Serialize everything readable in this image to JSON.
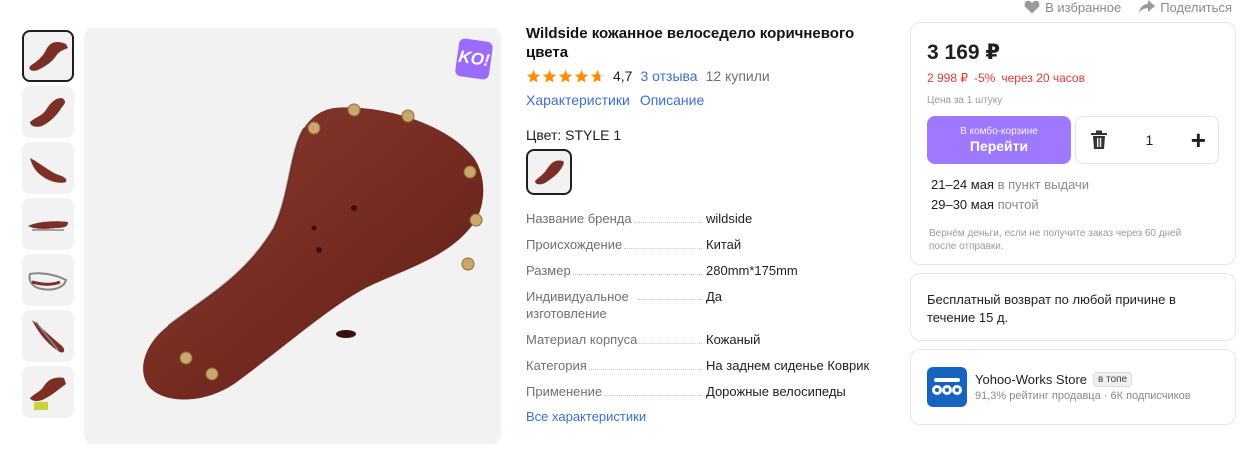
{
  "top_actions": {
    "favorite_label": "В избранное",
    "share_label": "Поделиться"
  },
  "gallery": {
    "thumbnails": [
      "thumb-1",
      "thumb-2",
      "thumb-3",
      "thumb-4",
      "thumb-5",
      "thumb-6",
      "thumb-7"
    ],
    "active_index": 0,
    "badge_text": "KO!"
  },
  "product": {
    "title": "Wildside кожанное велоседело коричневого цвета",
    "rating": "4,7",
    "rating_stars": 4.7,
    "reviews_link": "3 отзыва",
    "bought_text": "12 купили",
    "tab_characteristics": "Характеристики",
    "tab_description": "Описание",
    "color_label": "Цвет: STYLE 1",
    "specs": [
      {
        "key": "Название бренда",
        "value": "wildside"
      },
      {
        "key": "Происхождение",
        "value": "Китай"
      },
      {
        "key": "Размер",
        "value": "280mm*175mm"
      },
      {
        "key": "Индивидуальное изготовление",
        "value": "Да"
      },
      {
        "key": "Материал корпуса",
        "value": "Кожаный"
      },
      {
        "key": "Категория",
        "value": "На заднем сиденье Коврик"
      },
      {
        "key": "Применение",
        "value": "Дорожные велосипеды"
      }
    ],
    "all_specs_link": "Все характеристики"
  },
  "buy": {
    "price": "3 169 ₽",
    "discount_price": "2 998 ₽",
    "discount_percent": "-5%",
    "discount_time": "через 20 часов",
    "per_unit": "Цена за 1 штуку",
    "combo_small": "В комбо-корзине",
    "combo_big": "Перейти",
    "quantity": "1",
    "delivery": [
      {
        "date": "21–24 мая",
        "method": "в пункт выдачи"
      },
      {
        "date": "29–30 мая",
        "method": "почтой"
      }
    ],
    "refund_note": "Вернём деньги, если не получите заказ через 60 дней после отправки."
  },
  "return_policy": {
    "text": "Бесплатный возврат по любой причине в течение 15 д."
  },
  "store": {
    "name": "Yohoo-Works Store",
    "badge": "в топе",
    "rating_text": "91,3% рейтинг продавца",
    "subscribers": "6К подписчиков",
    "separator": "·"
  },
  "colors": {
    "accent_link": "#3b6fd4",
    "combo_button": "#9e78ff",
    "discount": "#e53935",
    "star": "#ff8c00",
    "store_logo": "#1565c0",
    "saddle": "#7b2f26"
  }
}
